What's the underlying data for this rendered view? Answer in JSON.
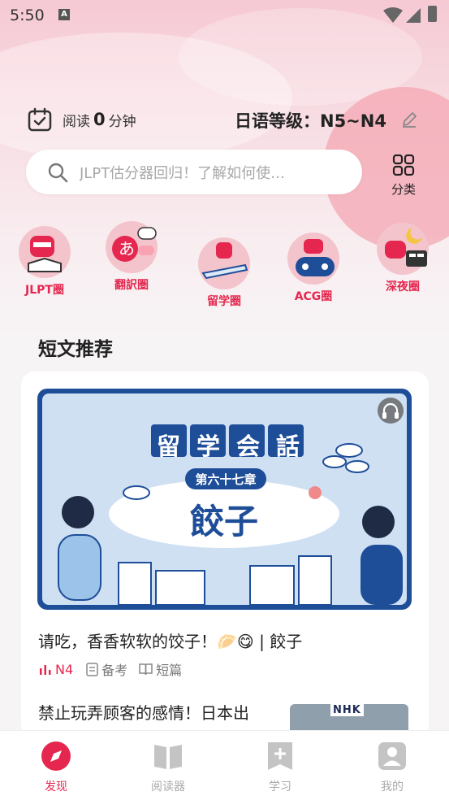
{
  "status_bar": {
    "time": "5:50"
  },
  "reading": {
    "prefix": "阅读",
    "minutes": "0",
    "unit": "分钟"
  },
  "level": {
    "text": "日语等级：N5~N4"
  },
  "search": {
    "placeholder": "JLPT估分器回归！了解如何使…"
  },
  "category": {
    "label": "分类"
  },
  "circles": [
    {
      "label": "JLPT圈"
    },
    {
      "label": "翻訳圏"
    },
    {
      "label": "留学圈"
    },
    {
      "label": "ACG圈"
    },
    {
      "label": "深夜圈"
    }
  ],
  "section": {
    "title": "短文推荐"
  },
  "banner": {
    "title": "留学会話",
    "chapter": "第六十七章",
    "subject": "餃子"
  },
  "article1": {
    "title": "请吃，香香软软的饺子！🥟😋 | 餃子",
    "level": "N4",
    "tag1": "备考",
    "tag2": "短篇"
  },
  "article2": {
    "title": "禁止玩弄顾客的感情！日本出",
    "thumb_logo": "NHK"
  },
  "bottom_nav": [
    {
      "label": "发现"
    },
    {
      "label": "阅读器"
    },
    {
      "label": "学习"
    },
    {
      "label": "我的"
    }
  ],
  "colors": {
    "accent": "#e5274f",
    "banner_navy": "#1f4e99",
    "banner_light": "#cfe0f3"
  }
}
